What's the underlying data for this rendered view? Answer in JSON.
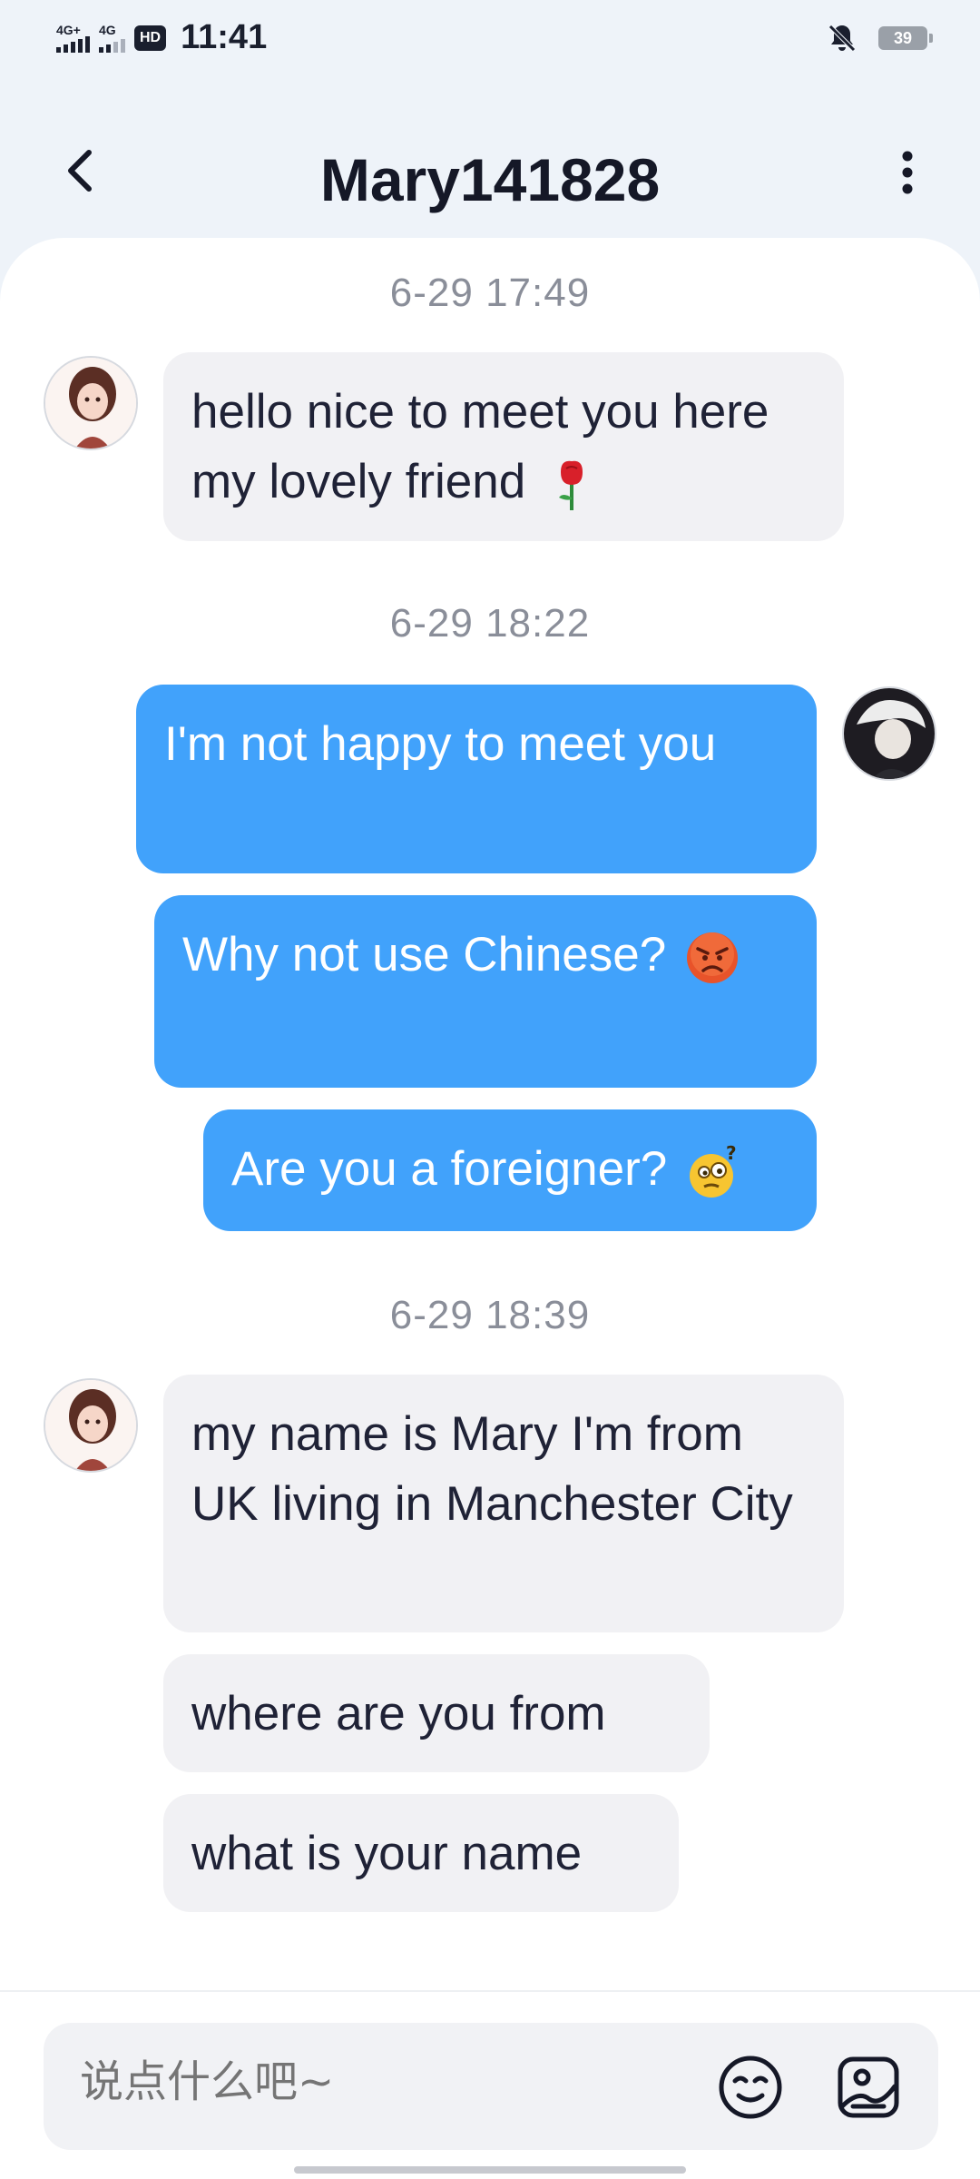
{
  "status_bar": {
    "network1": "4G+",
    "network2": "4G",
    "hd": "HD",
    "time": "11:41",
    "battery": "39"
  },
  "header": {
    "title": "Mary141828"
  },
  "messages": [
    {
      "type": "timestamp",
      "text": "6-29 17:49"
    },
    {
      "type": "incoming",
      "text": "hello nice to meet you here my lovely friend",
      "emoji": "rose-emoji"
    },
    {
      "type": "timestamp",
      "text": "6-29 18:22"
    },
    {
      "type": "outgoing",
      "text": "I'm not happy to meet you"
    },
    {
      "type": "outgoing",
      "text": "Why not use Chinese?",
      "emoji": "angry-face-emoji"
    },
    {
      "type": "outgoing",
      "text": "Are you a foreigner?",
      "emoji": "confused-face-emoji"
    },
    {
      "type": "timestamp",
      "text": "6-29 18:39"
    },
    {
      "type": "incoming",
      "text": "my name is Mary I'm from UK living in Manchester City"
    },
    {
      "type": "incoming",
      "text": "where are you from"
    },
    {
      "type": "incoming",
      "text": "what is your name"
    }
  ],
  "input": {
    "placeholder": "说点什么吧~"
  },
  "colors": {
    "outgoing_bubble": "#41a2fb",
    "incoming_bubble": "#f1f1f4",
    "background": "#eef3f9"
  }
}
